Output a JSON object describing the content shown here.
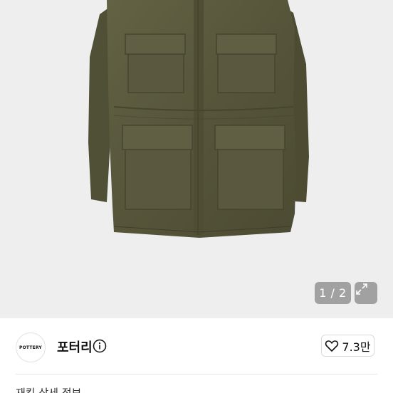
{
  "gallery": {
    "current": "1",
    "total": "2",
    "counter_text": "1 / 2"
  },
  "shop": {
    "logo_text": "POTTERY",
    "name": "포터리"
  },
  "likes": {
    "count": "7.3만"
  },
  "description": {
    "preview": "재킷 상세 정보"
  },
  "icons": {
    "expand": "expand-icon",
    "info": "info-icon",
    "heart": "heart-icon"
  },
  "colors": {
    "jacket": "#5b5a3c",
    "background": "#eeeeee"
  }
}
